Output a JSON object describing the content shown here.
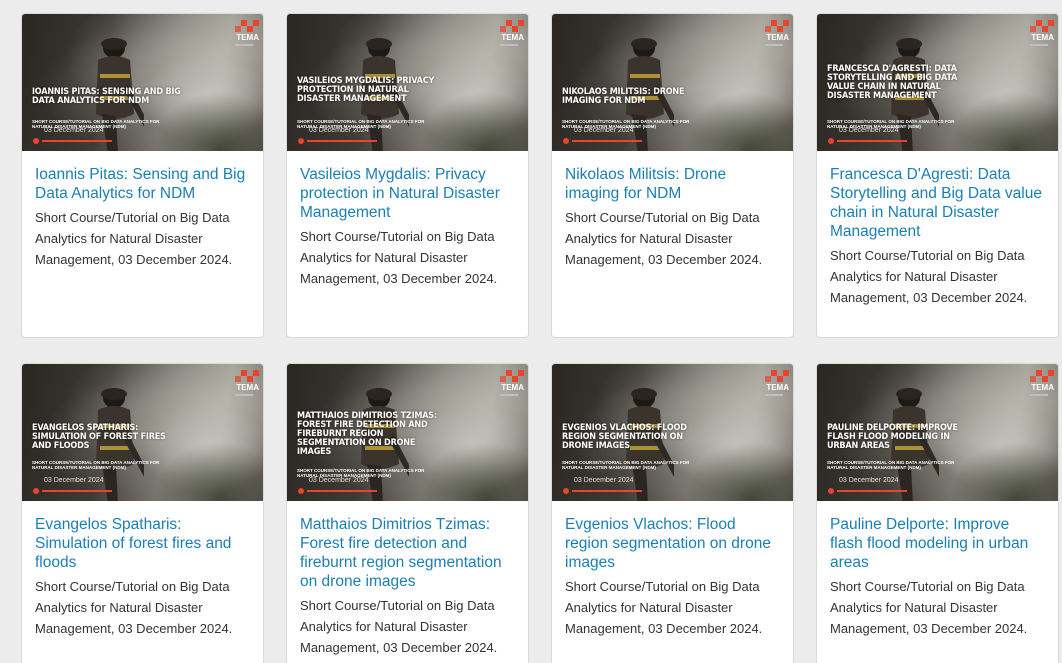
{
  "brand": {
    "logo_text": "TEMA",
    "accent": "#e8452c",
    "link_color": "#1a7fb4"
  },
  "cards": [
    {
      "thumb_title": "Ioannis Pitas: Sensing and Big Data Analytics for NDM",
      "thumb_sub": "Short Course/Tutorial on Big Data Analytics for Natural Disaster Management (NDM)",
      "thumb_date": "03 December 2024",
      "title": "Ioannis Pitas: Sensing and Big Data Analytics for NDM",
      "description": "Short Course/Tutorial on Big Data Analytics for Natural Disaster Management, 03 December 2024."
    },
    {
      "thumb_title": "Vasileios Mygdalis: Privacy Protection in Natural Disaster Management",
      "thumb_sub": "Short Course/Tutorial on Big Data Analytics for Natural Disaster Management (NDM)",
      "thumb_date": "03 December 2024",
      "title": "Vasileios Mygdalis: Privacy protection in Natural Disaster Management",
      "description": "Short Course/Tutorial on Big Data Analytics for Natural Disaster Management, 03 December 2024."
    },
    {
      "thumb_title": "Nikolaos Militsis: Drone Imaging for NDM",
      "thumb_sub": "Short Course/Tutorial on Big Data Analytics for Natural Disaster Management (NDM)",
      "thumb_date": "03 December 2024",
      "title": "Nikolaos Militsis: Drone imaging for NDM",
      "description": "Short Course/Tutorial on Big Data Analytics for Natural Disaster Management, 03 December 2024."
    },
    {
      "thumb_title": "Francesca D'Agresti: Data Storytelling and Big Data Value Chain in Natural Disaster Management",
      "thumb_sub": "Short Course/Tutorial on Big Data Analytics for Natural Disaster Management (NDM)",
      "thumb_date": "03 December 2024",
      "title": "Francesca D'Agresti: Data Storytelling and Big Data value chain in Natural Disaster Management",
      "description": "Short Course/Tutorial on Big Data Analytics for Natural Disaster Management, 03 December 2024."
    },
    {
      "thumb_title": "Evangelos Spatharis: Simulation of Forest Fires and Floods",
      "thumb_sub": "Short Course/Tutorial on Big Data Analytics for Natural Disaster Management (NDM)",
      "thumb_date": "03 December 2024",
      "title": "Evangelos Spatharis: Simulation of forest fires and floods",
      "description": "Short Course/Tutorial on Big Data Analytics for Natural Disaster Management, 03 December 2024."
    },
    {
      "thumb_title": "Matthaios Dimitrios Tzimas: Forest Fire Detection and Fireburnt Region Segmentation on Drone Images",
      "thumb_sub": "Short Course/Tutorial on Big Data Analytics for Natural Disaster Management (NDM)",
      "thumb_date": "03 December 2024",
      "title": "Matthaios Dimitrios Tzimas: Forest fire detection and fireburnt region segmentation on drone images",
      "description": "Short Course/Tutorial on Big Data Analytics for Natural Disaster Management, 03 December 2024."
    },
    {
      "thumb_title": "Evgenios Vlachos: Flood Region Segmentation on Drone Images",
      "thumb_sub": "Short Course/Tutorial on Big Data Analytics for Natural Disaster Management (NDM)",
      "thumb_date": "03 December 2024",
      "title": "Evgenios Vlachos: Flood region segmentation on drone images",
      "description": "Short Course/Tutorial on Big Data Analytics for Natural Disaster Management, 03 December 2024."
    },
    {
      "thumb_title": "Pauline Delporte: Improve Flash Flood Modeling in Urban Areas",
      "thumb_sub": "Short Course/Tutorial on Big Data Analytics for Natural Disaster Management (NDM)",
      "thumb_date": "03 December 2024",
      "title": "Pauline Delporte: Improve flash flood modeling in urban areas",
      "description": "Short Course/Tutorial on Big Data Analytics for Natural Disaster Management, 03 December 2024."
    }
  ]
}
